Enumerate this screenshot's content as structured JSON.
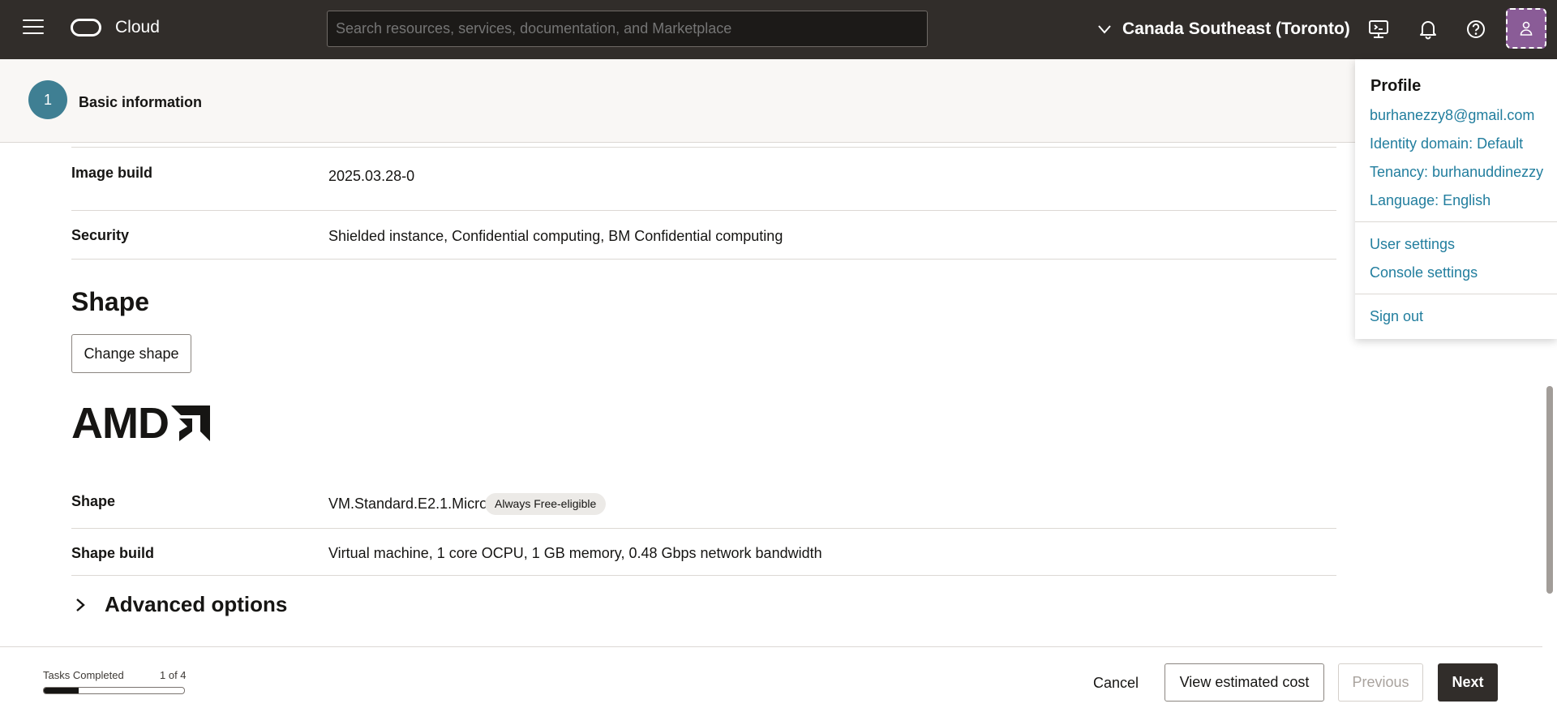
{
  "topbar": {
    "brand": "Cloud",
    "search_placeholder": "Search resources, services, documentation, and Marketplace",
    "region": "Canada Southeast (Toronto)",
    "icons": [
      "menu-icon",
      "oracle-logo",
      "chevron-down-icon",
      "cloud-shell-icon",
      "bell-icon",
      "help-icon",
      "user-icon"
    ],
    "avatar_color": "#8a5c97"
  },
  "stepper": {
    "step_number": "1",
    "step_label": "Basic information"
  },
  "image": {
    "build_label": "Image build",
    "build_value": "2025.03.28-0",
    "security_label": "Security",
    "security_value": "Shielded instance, Confidential computing, BM Confidential computing"
  },
  "shape": {
    "title": "Shape",
    "change_button": "Change shape",
    "vendor_logo": "AMD",
    "shape_label": "Shape",
    "shape_value": "VM.Standard.E2.1.Micro",
    "badge": "Always Free-eligible",
    "build_label": "Shape build",
    "build_value": "Virtual machine, 1 core OCPU, 1 GB memory, 0.48 Gbps network bandwidth"
  },
  "advanced": {
    "label": "Advanced options"
  },
  "footer": {
    "tasks_label": "Tasks Completed",
    "tasks_count": "1 of 4",
    "progress_fraction": 0.25,
    "cancel": "Cancel",
    "view_cost": "View estimated cost",
    "previous": "Previous",
    "next": "Next"
  },
  "profile_menu": {
    "heading": "Profile",
    "email": "burhanezzy8@gmail.com",
    "identity_domain": "Identity domain: Default",
    "tenancy": "Tenancy: burhanuddinezzy",
    "language": "Language: English",
    "user_settings": "User settings",
    "console_settings": "Console settings",
    "sign_out": "Sign out",
    "link_color": "#227e9e"
  },
  "colors": {
    "header_bg": "#312d2a",
    "step_bg": "#f9f7f5",
    "step_circle": "#3f7f93"
  }
}
